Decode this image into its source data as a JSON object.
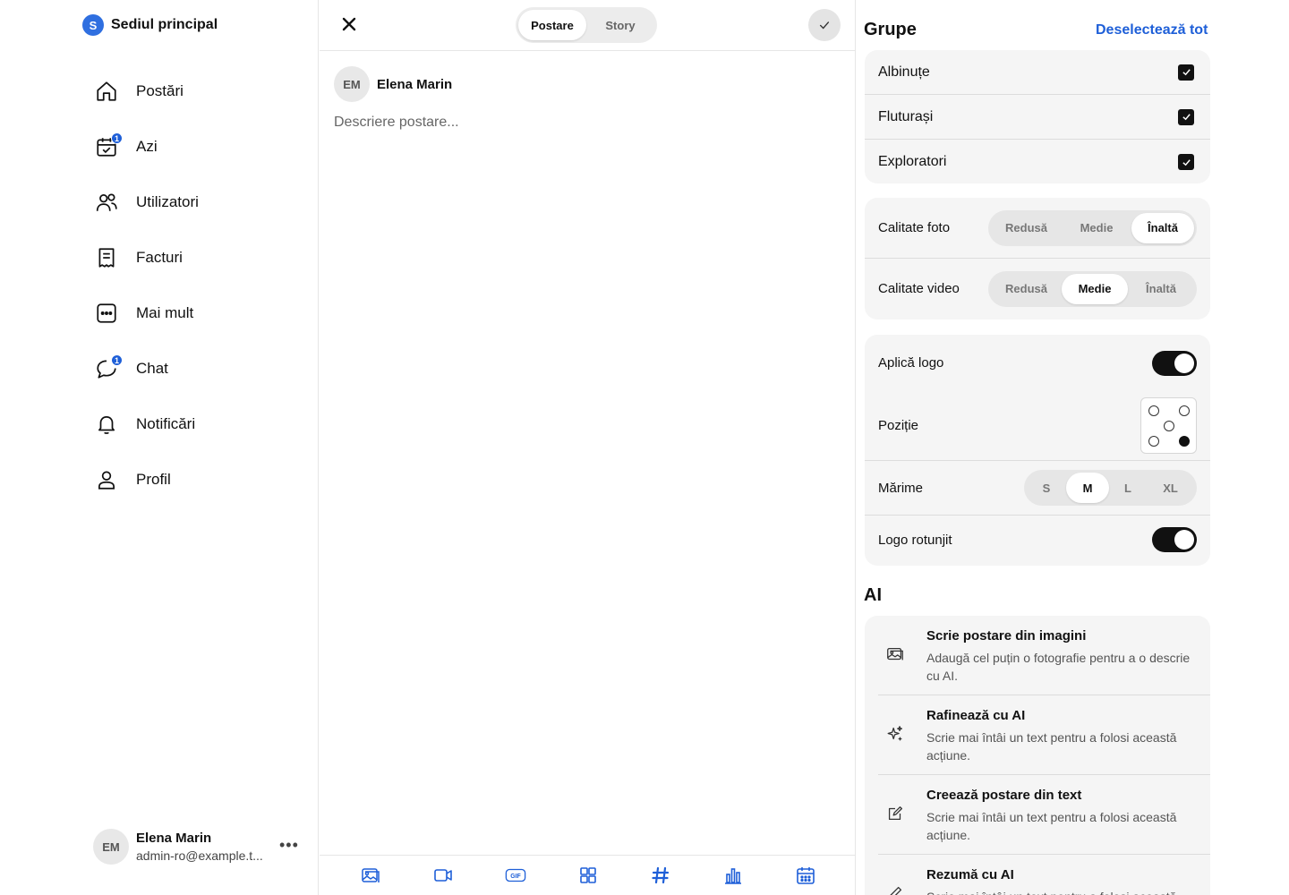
{
  "sidebar": {
    "org": {
      "initial": "S",
      "name": "Sediul principal"
    },
    "nav": [
      {
        "label": "Postări",
        "icon": "home-icon"
      },
      {
        "label": "Azi",
        "icon": "calendar-check-icon",
        "badge": "1"
      },
      {
        "label": "Utilizatori",
        "icon": "users-icon"
      },
      {
        "label": "Facturi",
        "icon": "invoice-icon"
      },
      {
        "label": "Mai mult",
        "icon": "more-icon"
      },
      {
        "label": "Chat",
        "icon": "chat-icon",
        "badge": "1"
      },
      {
        "label": "Notificări",
        "icon": "bell-icon"
      },
      {
        "label": "Profil",
        "icon": "user-icon"
      }
    ],
    "account": {
      "initials": "EM",
      "name": "Elena Marin",
      "email": "admin-ro@example.t..."
    }
  },
  "composer": {
    "tabs": [
      {
        "label": "Postare",
        "active": true
      },
      {
        "label": "Story",
        "active": false
      }
    ],
    "author": {
      "initials": "EM",
      "name": "Elena Marin"
    },
    "description": {
      "value": "",
      "placeholder": "Descriere postare..."
    },
    "toolbar": [
      "image-icon",
      "video-icon",
      "gif-icon",
      "grid-icon",
      "hashtag-icon",
      "poll-icon",
      "schedule-icon"
    ]
  },
  "panel": {
    "groups": {
      "title": "Grupe",
      "deselect_label": "Deselectează tot",
      "items": [
        {
          "label": "Albinuțe",
          "checked": true
        },
        {
          "label": "Fluturași",
          "checked": true
        },
        {
          "label": "Exploratori",
          "checked": true
        }
      ]
    },
    "quality": {
      "photo": {
        "label": "Calitate foto",
        "options": [
          "Redusă",
          "Medie",
          "Înaltă"
        ],
        "selected": "Înaltă"
      },
      "video": {
        "label": "Calitate video",
        "options": [
          "Redusă",
          "Medie",
          "Înaltă"
        ],
        "selected": "Medie"
      }
    },
    "logo": {
      "apply_label": "Aplică logo",
      "apply_on": true,
      "position_label": "Poziție",
      "position_selected": "bottom-right",
      "size_label": "Mărime",
      "size_options": [
        "S",
        "M",
        "L",
        "XL"
      ],
      "size_selected": "M",
      "rounded_label": "Logo rotunjit",
      "rounded_on": true
    },
    "ai": {
      "title": "AI",
      "items": [
        {
          "title": "Scrie postare din imagini",
          "subtitle": "Adaugă cel puțin o fotografie pentru a o descrie cu AI.",
          "icon": "image-icon"
        },
        {
          "title": "Rafinează cu AI",
          "subtitle": "Scrie mai întâi un text pentru a folosi această acțiune.",
          "icon": "sparkles-icon"
        },
        {
          "title": "Creează postare din text",
          "subtitle": "Scrie mai întâi un text pentru a folosi această acțiune.",
          "icon": "edit-icon"
        },
        {
          "title": "Rezumă cu AI",
          "subtitle": "Scrie mai întâi un text pentru a folosi această acțiune.",
          "icon": "pen-icon"
        }
      ]
    }
  },
  "colors": {
    "accent": "#1e5fd8",
    "org_badge": "#2f6fe0",
    "card_bg": "#f5f5f5"
  }
}
